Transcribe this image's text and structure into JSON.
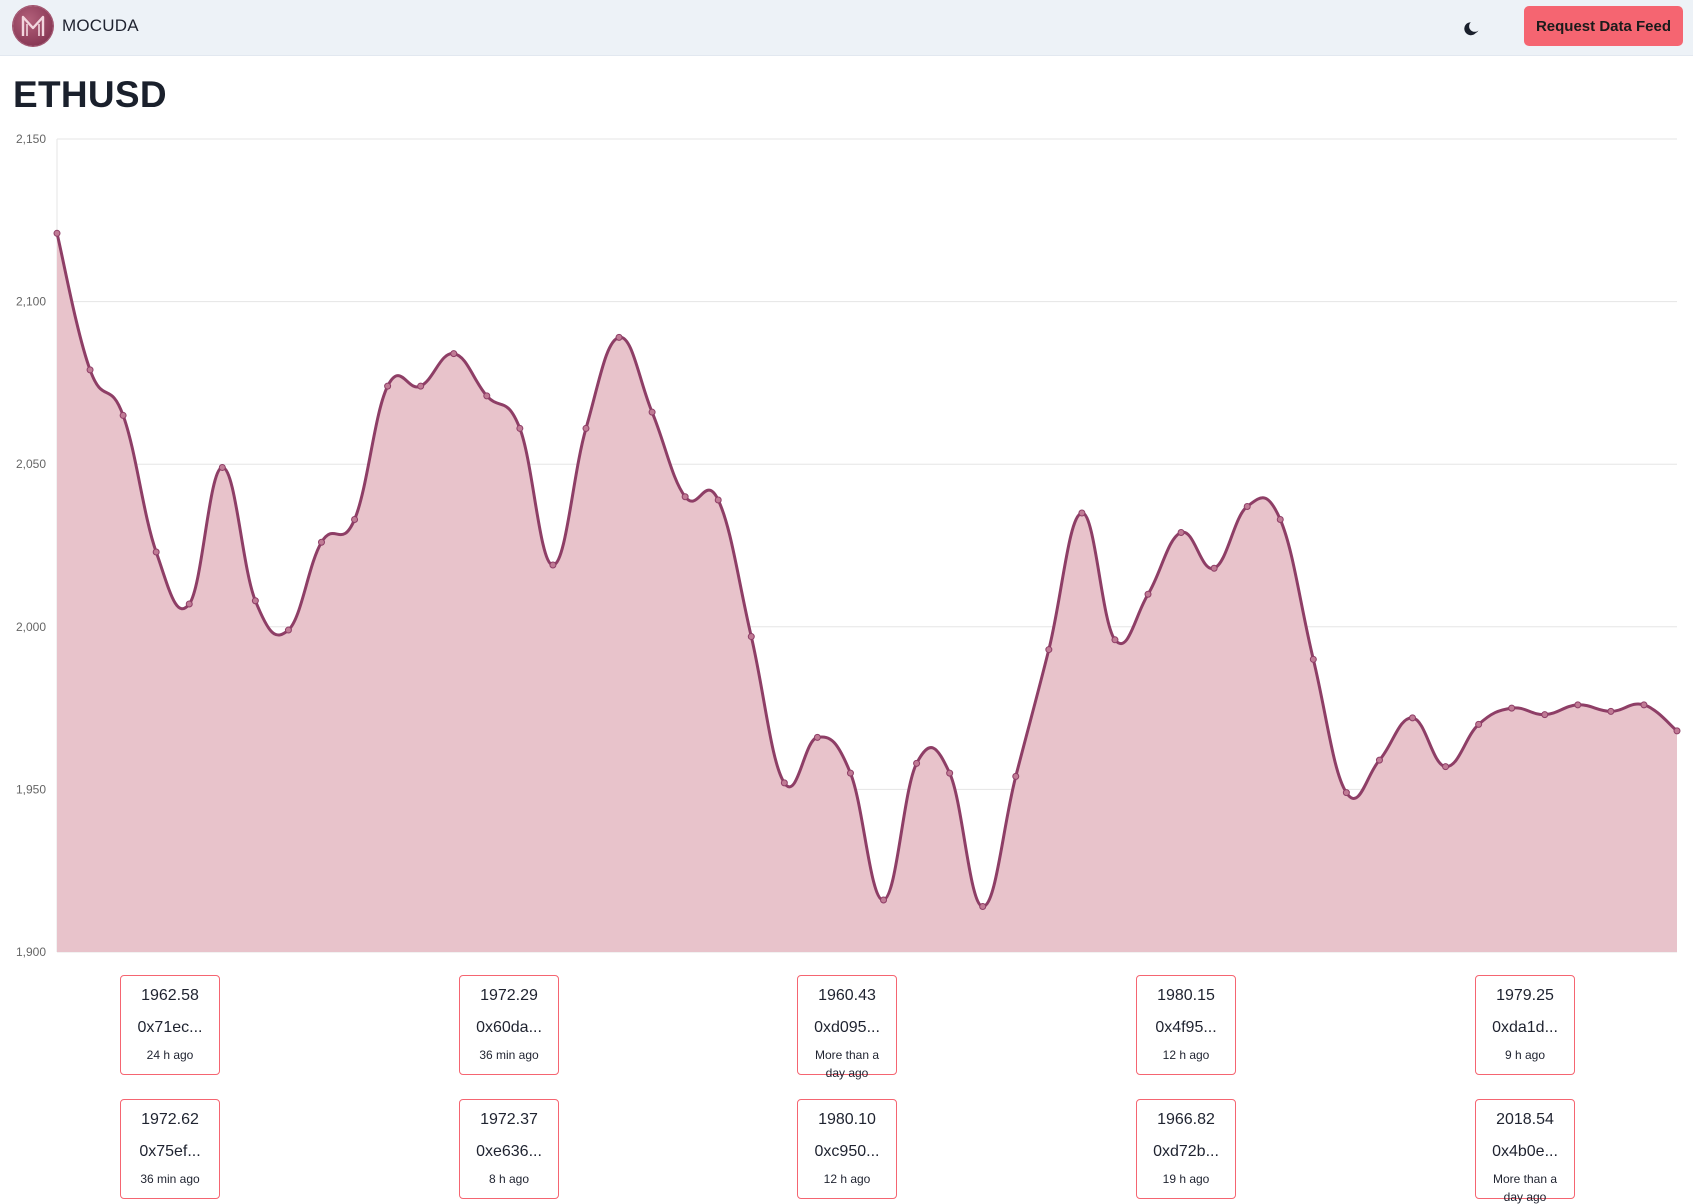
{
  "navbar": {
    "brand": "MOCUDA",
    "theme_icon": "moon-icon",
    "request_button": "Request Data Feed",
    "accent_color": "#f56571"
  },
  "page": {
    "title": "ETHUSD"
  },
  "chart_data": {
    "type": "area",
    "title": "ETHUSD",
    "xlabel": "",
    "ylabel": "",
    "ylim": [
      1900,
      2150
    ],
    "y_ticks": [
      "2,150",
      "2,100",
      "2,050",
      "2,000",
      "1,950",
      "1,900"
    ],
    "grid": true,
    "line_color": "#8e3e66",
    "fill_color": "#e8c3cb",
    "series": [
      {
        "values": [
          2121,
          2079,
          2065,
          2023,
          2007,
          2049,
          2008,
          1999,
          2026,
          2033,
          2074,
          2074,
          2084,
          2071,
          2061,
          2019,
          2061,
          2089,
          2066,
          2040,
          2039,
          1997,
          1952,
          1966,
          1955,
          1916,
          1958,
          1955,
          1914,
          1954,
          1993,
          2035,
          1996,
          2010,
          2029,
          2018,
          2037,
          2033,
          1990,
          1949,
          1959,
          1972,
          1957,
          1970,
          1975,
          1973,
          1976,
          1974,
          1976,
          1968
        ]
      }
    ]
  },
  "feeds": [
    {
      "value": "1962.58",
      "address": "0x71ec...",
      "time": "24 h ago"
    },
    {
      "value": "1972.29",
      "address": "0x60da...",
      "time": "36 min ago"
    },
    {
      "value": "1960.43",
      "address": "0xd095...",
      "time": "More than a day ago"
    },
    {
      "value": "1980.15",
      "address": "0x4f95...",
      "time": "12 h ago"
    },
    {
      "value": "1979.25",
      "address": "0xda1d...",
      "time": "9 h ago"
    },
    {
      "value": "1972.62",
      "address": "0x75ef...",
      "time": "36 min ago"
    },
    {
      "value": "1972.37",
      "address": "0xe636...",
      "time": "8 h ago"
    },
    {
      "value": "1980.10",
      "address": "0xc950...",
      "time": "12 h ago"
    },
    {
      "value": "1966.82",
      "address": "0xd72b...",
      "time": "19 h ago"
    },
    {
      "value": "2018.54",
      "address": "0x4b0e...",
      "time": "More than a day ago"
    }
  ]
}
